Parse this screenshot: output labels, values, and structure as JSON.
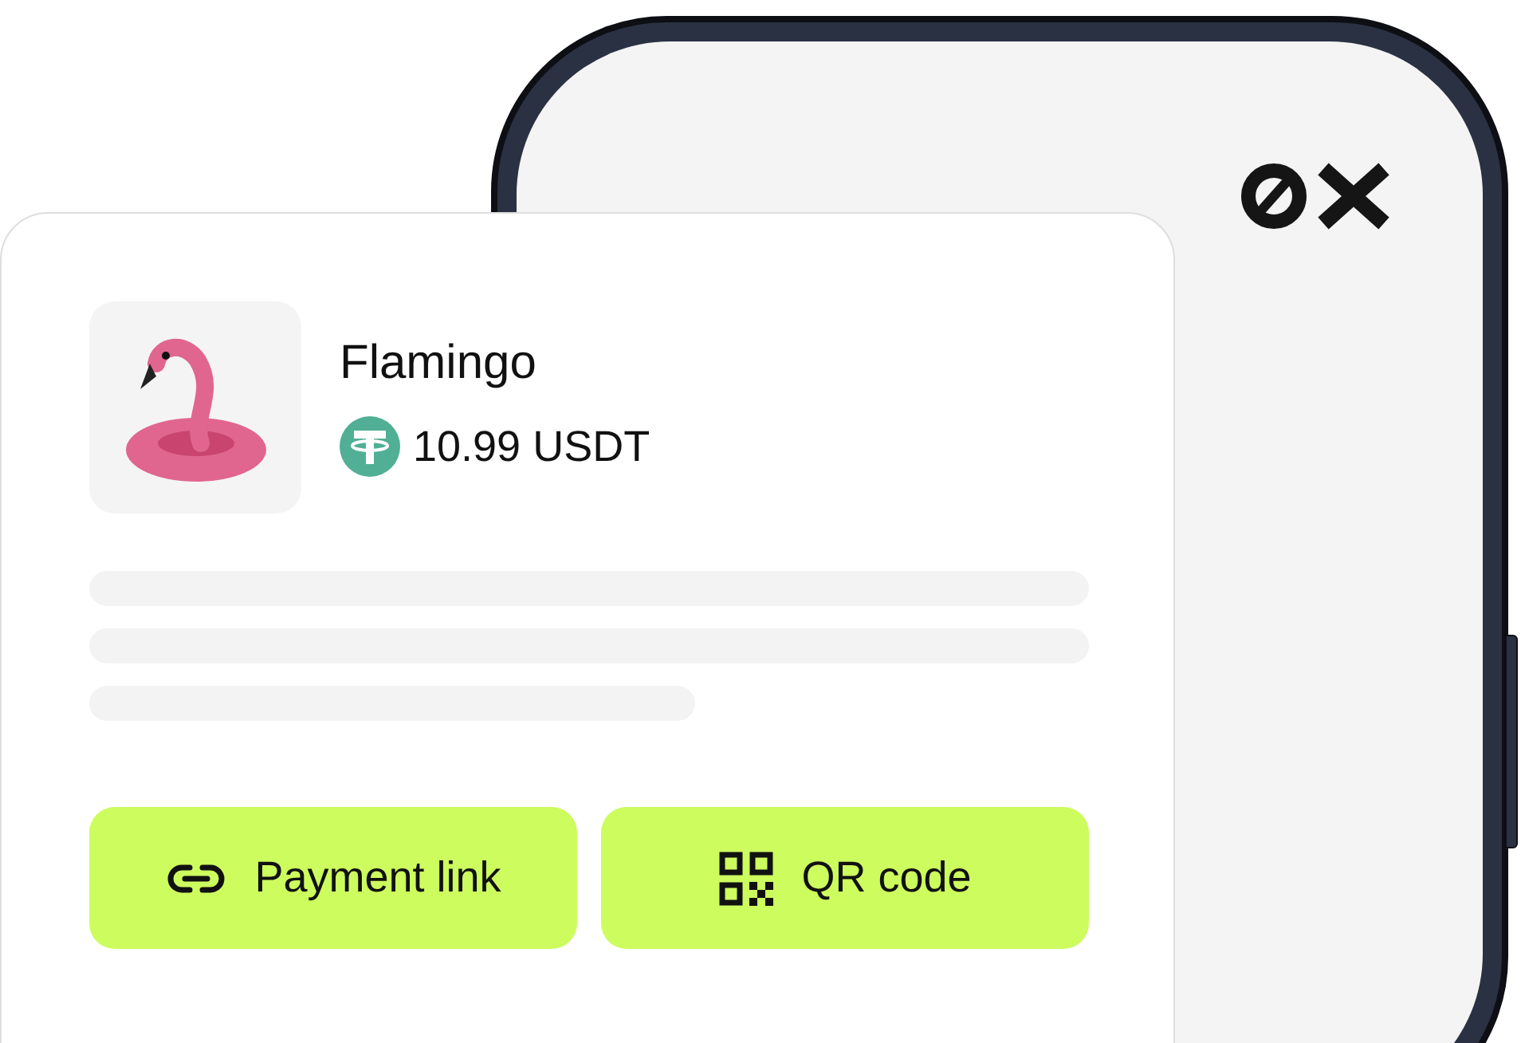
{
  "product": {
    "name": "Flamingo",
    "price": "10.99 USDT"
  },
  "description_lines": [
    {
      "kind": "full"
    },
    {
      "kind": "full"
    },
    {
      "kind": "short"
    }
  ],
  "buttons": [
    {
      "kind": "link",
      "label": "Payment link"
    },
    {
      "kind": "qr",
      "label": "QR code"
    }
  ]
}
